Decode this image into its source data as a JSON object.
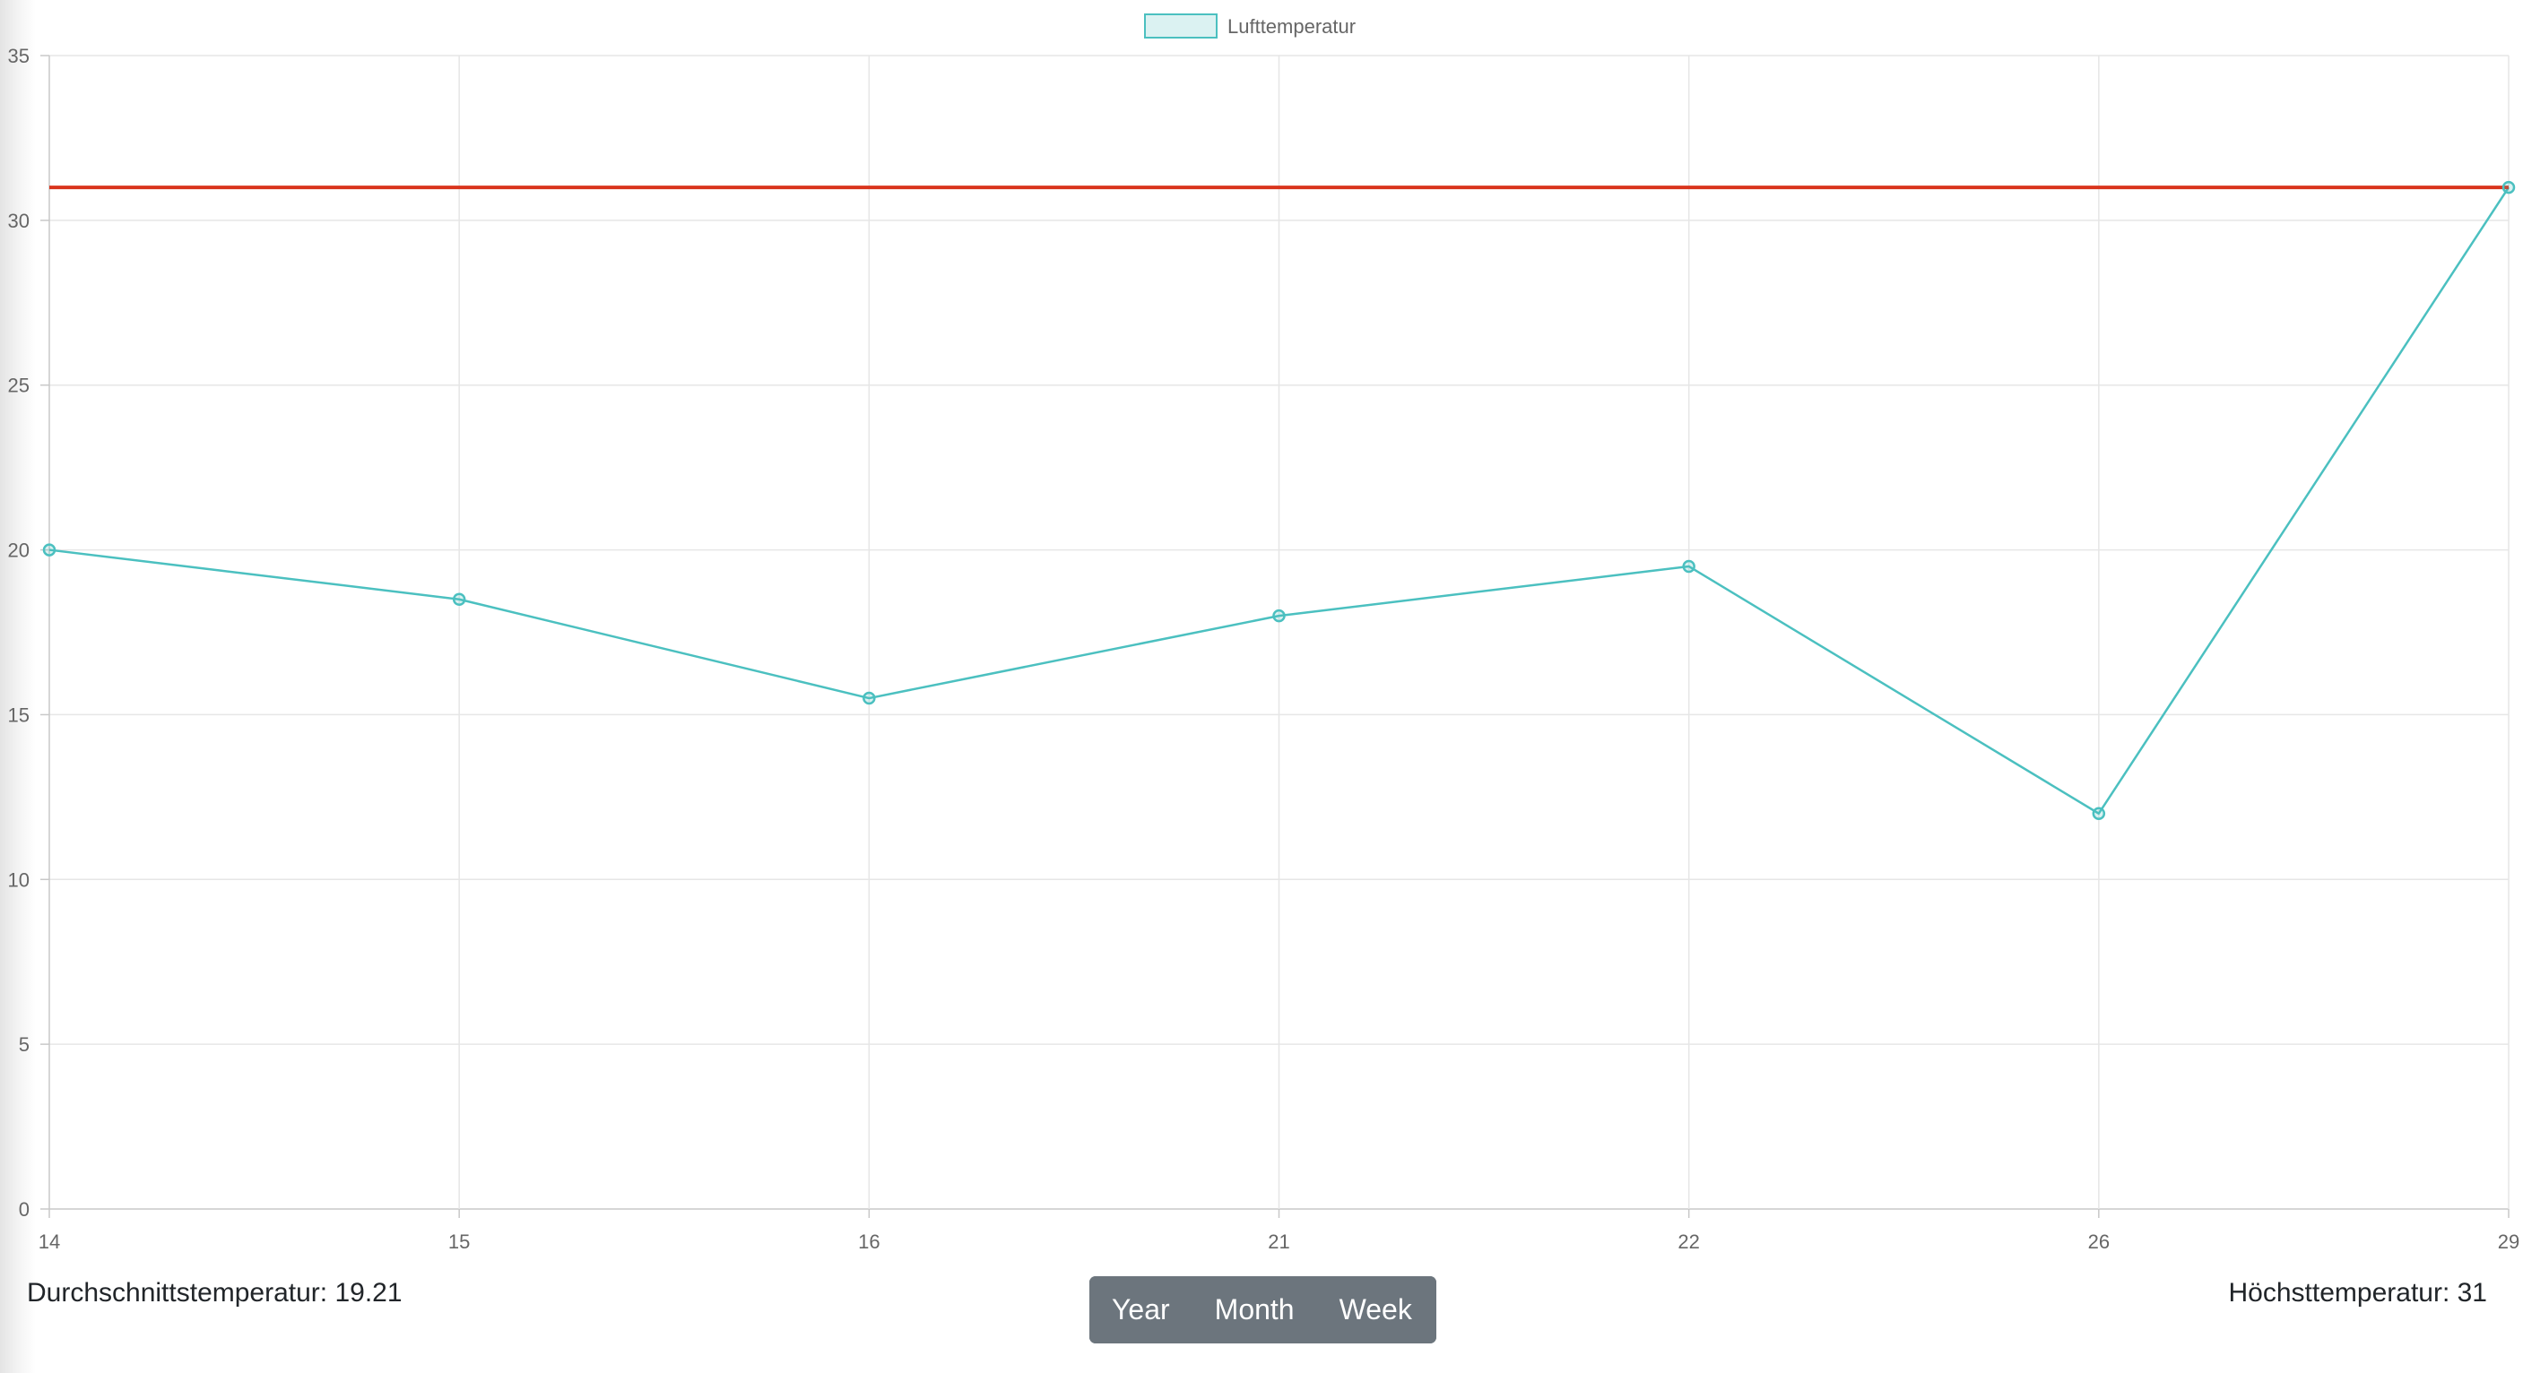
{
  "chart_data": {
    "type": "line",
    "categories": [
      "14",
      "15",
      "16",
      "21",
      "22",
      "26",
      "29"
    ],
    "series": [
      {
        "name": "Lufttemperatur",
        "values": [
          20,
          18.5,
          15.5,
          18,
          19.5,
          12,
          31
        ],
        "color": "#4bc0c0",
        "fill": "rgba(75,192,192,0.2)"
      }
    ],
    "reference_line": {
      "value": 31,
      "color": "#d9341c"
    },
    "ylim": [
      0,
      35
    ],
    "yticks": [
      0,
      5,
      10,
      15,
      20,
      25,
      30,
      35
    ],
    "grid": true,
    "legend": "top-center",
    "title": "",
    "xlabel": "",
    "ylabel": ""
  },
  "stats": {
    "average_label": "Durchschnittstemperatur: 19.21",
    "max_label": "Höchsttemperatur: 31"
  },
  "range_buttons": {
    "year": "Year",
    "month": "Month",
    "week": "Week"
  }
}
